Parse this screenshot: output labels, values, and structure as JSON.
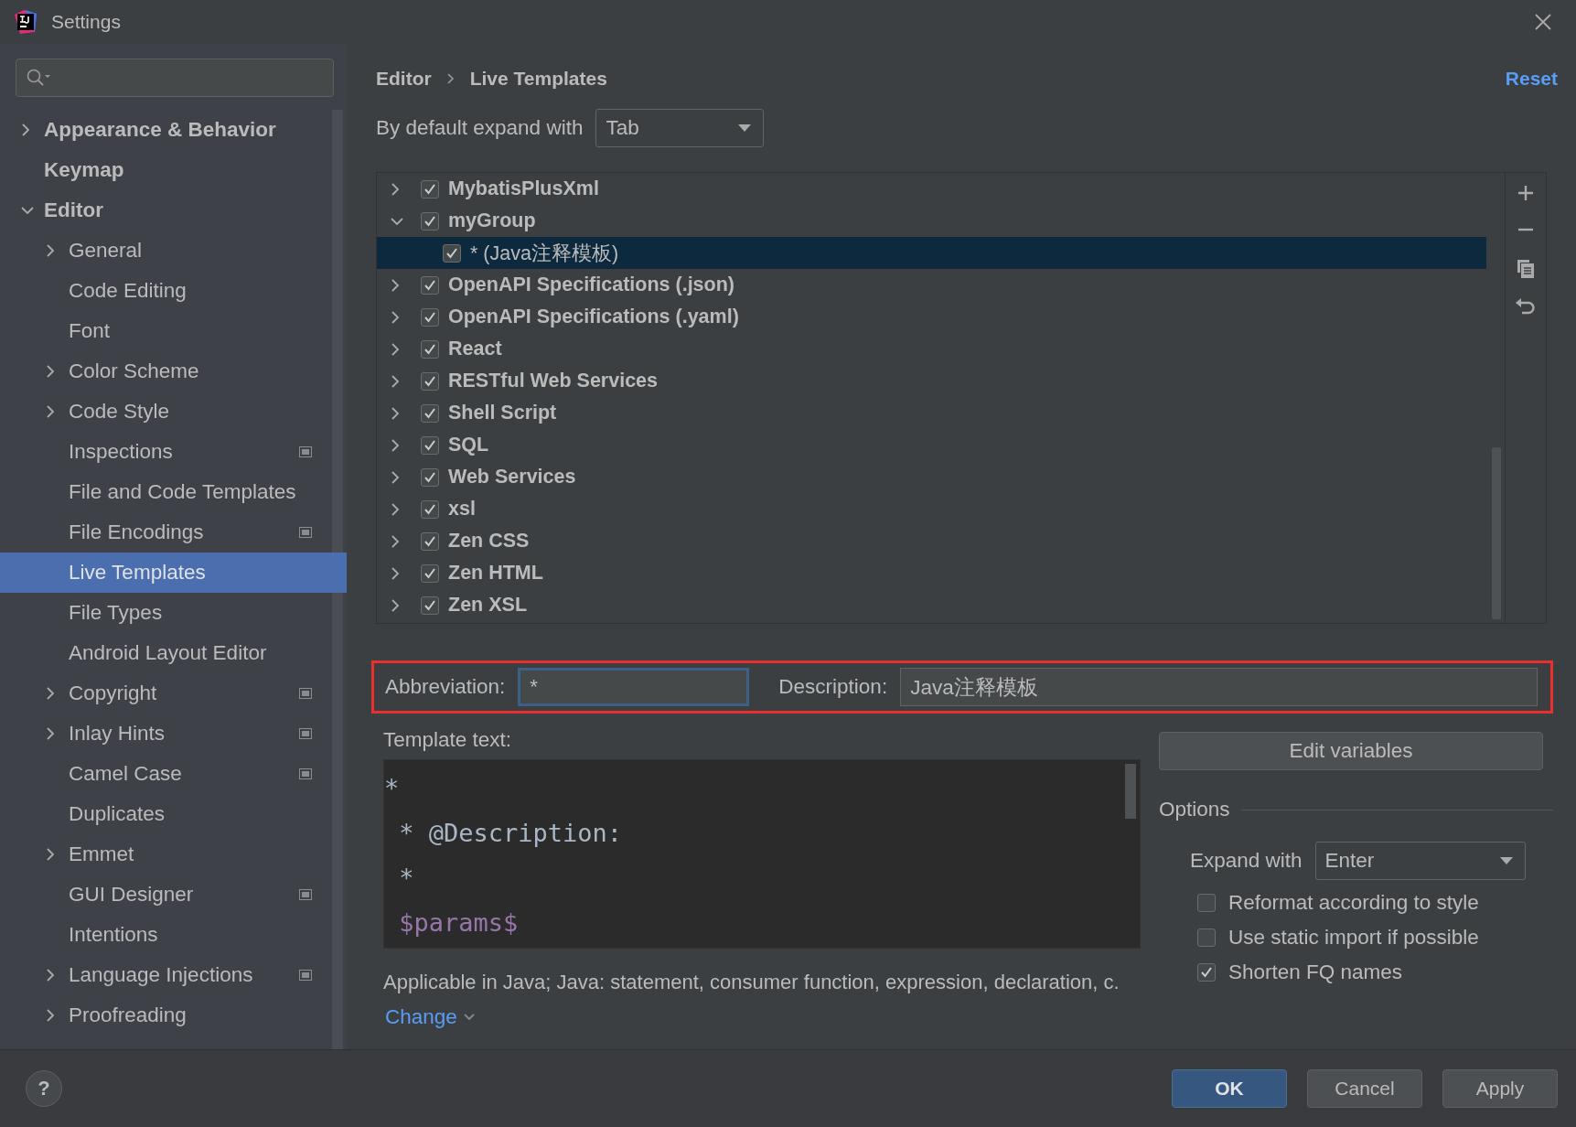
{
  "window": {
    "title": "Settings"
  },
  "sidebar": {
    "items": [
      {
        "label": "Appearance & Behavior",
        "expandable": true,
        "expanded": false,
        "selected": false,
        "project_badge": false
      },
      {
        "label": "Keymap",
        "expandable": false,
        "expanded": false,
        "selected": false,
        "project_badge": false
      },
      {
        "label": "Editor",
        "expandable": true,
        "expanded": true,
        "selected": false,
        "project_badge": false,
        "children": [
          {
            "label": "General",
            "expandable": true,
            "expanded": false,
            "selected": false,
            "project_badge": false
          },
          {
            "label": "Code Editing",
            "expandable": false,
            "expanded": false,
            "selected": false,
            "project_badge": false
          },
          {
            "label": "Font",
            "expandable": false,
            "expanded": false,
            "selected": false,
            "project_badge": false
          },
          {
            "label": "Color Scheme",
            "expandable": true,
            "expanded": false,
            "selected": false,
            "project_badge": false
          },
          {
            "label": "Code Style",
            "expandable": true,
            "expanded": false,
            "selected": false,
            "project_badge": false
          },
          {
            "label": "Inspections",
            "expandable": false,
            "expanded": false,
            "selected": false,
            "project_badge": true
          },
          {
            "label": "File and Code Templates",
            "expandable": false,
            "expanded": false,
            "selected": false,
            "project_badge": false
          },
          {
            "label": "File Encodings",
            "expandable": false,
            "expanded": false,
            "selected": false,
            "project_badge": true
          },
          {
            "label": "Live Templates",
            "expandable": false,
            "expanded": false,
            "selected": true,
            "project_badge": false
          },
          {
            "label": "File Types",
            "expandable": false,
            "expanded": false,
            "selected": false,
            "project_badge": false
          },
          {
            "label": "Android Layout Editor",
            "expandable": false,
            "expanded": false,
            "selected": false,
            "project_badge": false
          },
          {
            "label": "Copyright",
            "expandable": true,
            "expanded": false,
            "selected": false,
            "project_badge": true
          },
          {
            "label": "Inlay Hints",
            "expandable": true,
            "expanded": false,
            "selected": false,
            "project_badge": true
          },
          {
            "label": "Camel Case",
            "expandable": false,
            "expanded": false,
            "selected": false,
            "project_badge": true
          },
          {
            "label": "Duplicates",
            "expandable": false,
            "expanded": false,
            "selected": false,
            "project_badge": false
          },
          {
            "label": "Emmet",
            "expandable": true,
            "expanded": false,
            "selected": false,
            "project_badge": false
          },
          {
            "label": "GUI Designer",
            "expandable": false,
            "expanded": false,
            "selected": false,
            "project_badge": true
          },
          {
            "label": "Intentions",
            "expandable": false,
            "expanded": false,
            "selected": false,
            "project_badge": false
          },
          {
            "label": "Language Injections",
            "expandable": true,
            "expanded": false,
            "selected": false,
            "project_badge": true
          },
          {
            "label": "Proofreading",
            "expandable": true,
            "expanded": false,
            "selected": false,
            "project_badge": false
          }
        ]
      }
    ]
  },
  "breadcrumb": [
    "Editor",
    "Live Templates"
  ],
  "reset_link": "Reset",
  "default_expand": {
    "label": "By default expand with",
    "value": "Tab"
  },
  "template_groups": [
    {
      "label": "MybatisPlusXml",
      "checked": true,
      "expanded": false,
      "selected": false
    },
    {
      "label": "myGroup",
      "checked": true,
      "expanded": true,
      "selected": false,
      "children": [
        {
          "label": "* (Java注释模板)",
          "checked": true,
          "selected": true
        }
      ]
    },
    {
      "label": "OpenAPI Specifications (.json)",
      "checked": true,
      "expanded": false,
      "selected": false
    },
    {
      "label": "OpenAPI Specifications (.yaml)",
      "checked": true,
      "expanded": false,
      "selected": false
    },
    {
      "label": "React",
      "checked": true,
      "expanded": false,
      "selected": false
    },
    {
      "label": "RESTful Web Services",
      "checked": true,
      "expanded": false,
      "selected": false
    },
    {
      "label": "Shell Script",
      "checked": true,
      "expanded": false,
      "selected": false
    },
    {
      "label": "SQL",
      "checked": true,
      "expanded": false,
      "selected": false
    },
    {
      "label": "Web Services",
      "checked": true,
      "expanded": false,
      "selected": false
    },
    {
      "label": "xsl",
      "checked": true,
      "expanded": false,
      "selected": false
    },
    {
      "label": "Zen CSS",
      "checked": true,
      "expanded": false,
      "selected": false
    },
    {
      "label": "Zen HTML",
      "checked": true,
      "expanded": false,
      "selected": false
    },
    {
      "label": "Zen XSL",
      "checked": true,
      "expanded": false,
      "selected": false
    }
  ],
  "template_editor": {
    "highlighted": true,
    "abbreviation": {
      "label": "Abbreviation:",
      "value": "*",
      "focused": true
    },
    "description": {
      "label": "Description:",
      "value": "Java注释模板"
    },
    "template_text_label": "Template text:",
    "template_lines": [
      {
        "text": "*",
        "kind": "text"
      },
      {
        "text": " * @Description:",
        "kind": "text"
      },
      {
        "text": " *",
        "kind": "text"
      },
      {
        "text": " $params$",
        "kind": "variable"
      }
    ],
    "applicable": "Applicable in Java; Java: statement, consumer function, expression, declaration, c.",
    "change_link": "Change",
    "edit_variables": "Edit variables",
    "options": {
      "title": "Options",
      "expand_with": {
        "label": "Expand with",
        "value": "Enter"
      },
      "checkboxes": [
        {
          "label": "Reformat according to style",
          "checked": false
        },
        {
          "label": "Use static import if possible",
          "checked": false
        },
        {
          "label": "Shorten FQ names",
          "checked": true
        }
      ]
    }
  },
  "footer": {
    "help": "?",
    "buttons": [
      {
        "label": "OK",
        "default": true
      },
      {
        "label": "Cancel",
        "default": false
      },
      {
        "label": "Apply",
        "default": false
      }
    ]
  }
}
